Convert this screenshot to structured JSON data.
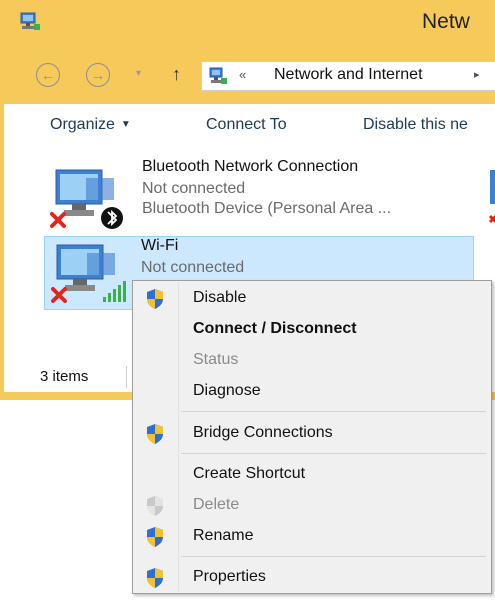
{
  "window": {
    "title": "Netw"
  },
  "address": {
    "chevron": "«",
    "path": "Network and Internet",
    "separator": "▸"
  },
  "nav": {
    "back": "←",
    "forward": "→",
    "dropdown": "▾",
    "up": "↑"
  },
  "toolbar": {
    "organize": "Organize",
    "organize_caret": "▼",
    "connect_to": "Connect To",
    "disable": "Disable this ne"
  },
  "connections": [
    {
      "name": "Bluetooth Network Connection",
      "status": "Not connected",
      "device": "Bluetooth Device (Personal Area ..."
    },
    {
      "name": "Wi-Fi",
      "status": "Not connected"
    }
  ],
  "statusbar": {
    "items": "3 items"
  },
  "menu": {
    "items": [
      {
        "label": "Disable",
        "shield": true,
        "style": "normal"
      },
      {
        "label": "Connect / Disconnect",
        "shield": false,
        "style": "bold"
      },
      {
        "label": "Status",
        "shield": false,
        "style": "disabled"
      },
      {
        "label": "Diagnose",
        "shield": false,
        "style": "normal"
      },
      {
        "label": "Bridge Connections",
        "shield": true,
        "style": "normal"
      },
      {
        "label": "Create Shortcut",
        "shield": false,
        "style": "normal"
      },
      {
        "label": "Delete",
        "shield": true,
        "style": "disabled"
      },
      {
        "label": "Rename",
        "shield": true,
        "style": "normal"
      },
      {
        "label": "Properties",
        "shield": true,
        "style": "normal"
      }
    ]
  },
  "colors": {
    "frame": "#f6c95b",
    "selection": "#cce8ff",
    "shield_blue": "#2f6fd1",
    "shield_yellow": "#f2c12e"
  }
}
